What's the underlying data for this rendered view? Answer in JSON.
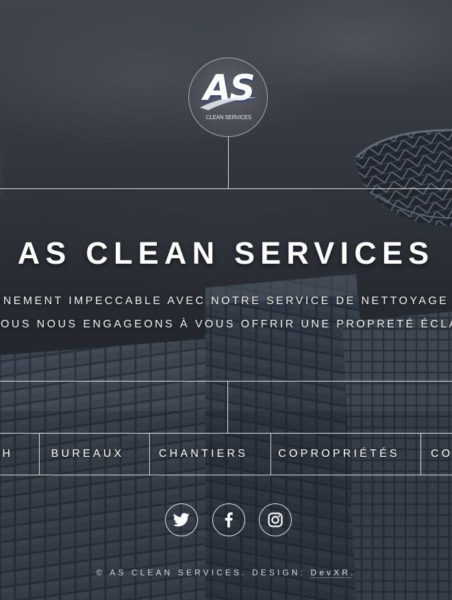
{
  "logo": {
    "mark": "AS",
    "subtitle": "CLEAN SERVICES"
  },
  "hero": {
    "title": "AS CLEAN SERVICES",
    "tagline_line1": "ENVIRONNEMENT IMPECCABLE AVEC NOTRE SERVICE DE NETTOYAGE",
    "tagline_line2": "NOUS NOUS ENGAGEONS À VOUS OFFRIR UNE PROPRETÉ ÉCLATANTE À CHAQUE"
  },
  "nav": {
    "items": [
      {
        "label": "CAR WASH"
      },
      {
        "label": "BUREAUX"
      },
      {
        "label": "CHANTIERS"
      },
      {
        "label": "COPROPRIÉTÉS"
      },
      {
        "label": "CONTACT"
      }
    ]
  },
  "social": {
    "items": [
      {
        "icon": "twitter-icon"
      },
      {
        "icon": "facebook-icon"
      },
      {
        "icon": "instagram-icon"
      }
    ]
  },
  "footer": {
    "copyright": "© AS CLEAN SERVICES. DESIGN: ",
    "design_link": "DevXR",
    "trailing": "."
  },
  "colors": {
    "text": "#ffffff",
    "lines": "#ffffff",
    "overlay": "#1d2026"
  }
}
